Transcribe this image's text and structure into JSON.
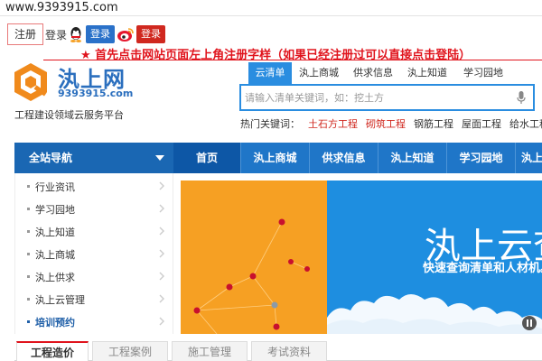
{
  "url": "www.9393915.com",
  "top_bar": {
    "register_link": "注册",
    "login_text": "登录",
    "qq_login": "登录",
    "weibo_login": "登录"
  },
  "instruction": "★ 首先点击网站页面左上角注册字样（如果已经注册过可以直接点击登陆）",
  "logo": {
    "name": "汍上网",
    "domain": "9393915.com",
    "slogan": "工程建设领域云服务平台"
  },
  "search": {
    "tabs": [
      "云清单",
      "汍上商城",
      "供求信息",
      "汍上知道",
      "学习园地"
    ],
    "active_tab": 0,
    "placeholder": "请输入清单关键词，如：挖土方",
    "hot_label": "热门关键词：",
    "hot_keywords": [
      "土石方工程",
      "砌筑工程",
      "钢筋工程",
      "屋面工程",
      "给水工程"
    ]
  },
  "nav": {
    "all_label": "全站导航",
    "items": [
      "首页",
      "汍上商城",
      "供求信息",
      "汍上知道",
      "学习园地",
      "汍上"
    ]
  },
  "sidebar": {
    "items": [
      "行业资讯",
      "学习园地",
      "汍上知道",
      "汍上商城",
      "汍上供求",
      "汍上云管理",
      "培训预约"
    ]
  },
  "banner": {
    "title": "汍上云查",
    "subtitle": "快速查询清单和人材机。"
  },
  "bottom_tabs": [
    "工程造价",
    "工程案例",
    "施工管理",
    "考试资料"
  ],
  "colors": {
    "brand_blue": "#1f76c8",
    "accent_red": "#e0141d",
    "banner_orange": "#f6a023"
  }
}
